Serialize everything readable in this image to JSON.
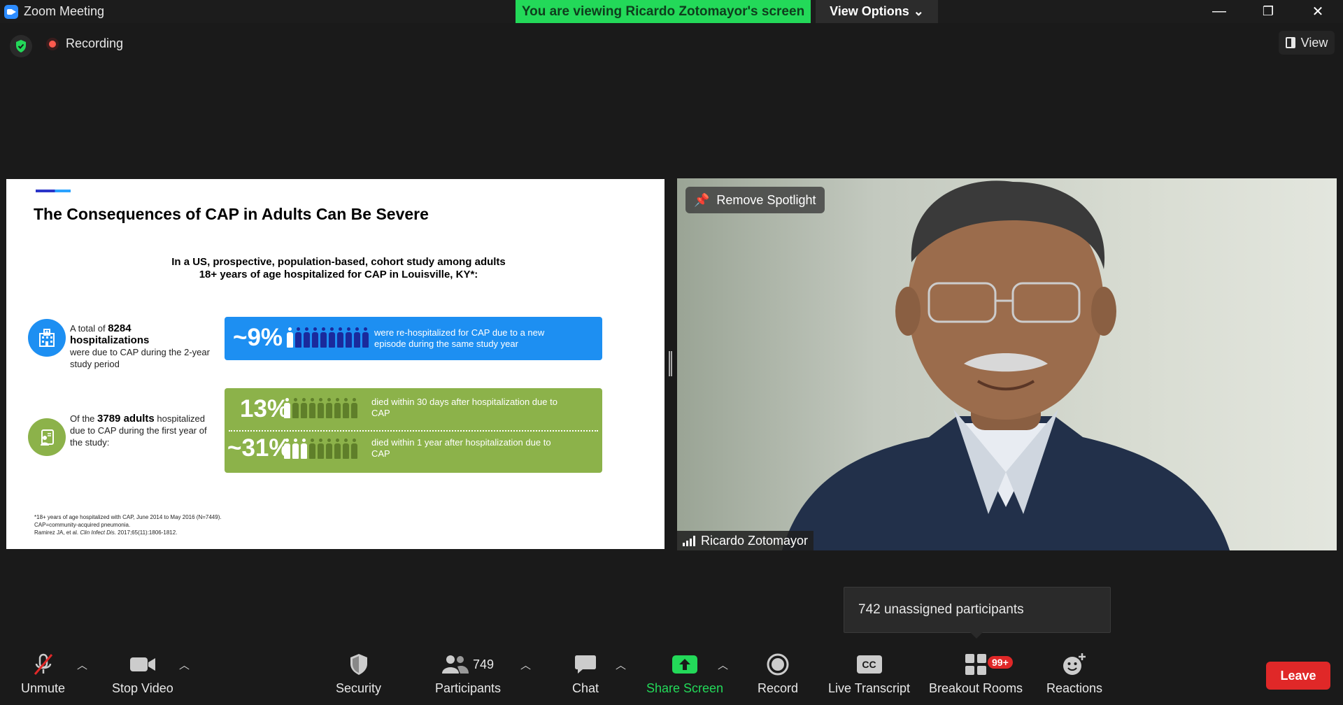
{
  "window": {
    "title": "Zoom Meeting",
    "viewing_banner": "You are viewing Ricardo Zotomayor's screen",
    "view_options": "View Options",
    "minimize": "—",
    "restore": "❐",
    "close": "✕"
  },
  "status": {
    "recording_label": "Recording",
    "view_label": "View"
  },
  "slide": {
    "title": "The Consequences of CAP in Adults Can Be Severe",
    "subtitle_line1": "In a US, prospective, population-based, cohort study among adults",
    "subtitle_line2": "18+ years of age hospitalized for CAP in Louisville, KY*:",
    "block1_prefix": "A total of ",
    "block1_bold": "8284 hospitalizations",
    "block1_rest": "were due to CAP during the 2-year study period",
    "block2_prefix": "Of the ",
    "block2_bold": "3789 adults",
    "block2_rest": " hospitalized due to CAP during the first year of the study:",
    "stat1_pct": "~9%",
    "stat1_text": "were re-hospitalized for CAP due to a new episode during the same study year",
    "stat2_pct": "13%",
    "stat2_text": "died within 30 days after hospitalization due to CAP",
    "stat3_pct": "~31%",
    "stat3_text": "died within 1 year after hospitalization due to CAP",
    "footnote1": "*18+ years of age hospitalized with CAP, June 2014 to May 2016 (N=7449).",
    "footnote2": "CAP=community-acquired pneumonia.",
    "footnote3_a": "Ramirez JA, et al. ",
    "footnote3_b": "Clin Infect Dis.",
    "footnote3_c": " 2017;65(11):1806-1812."
  },
  "video": {
    "remove_spotlight": "Remove Spotlight",
    "participant_name": "Ricardo Zotomayor"
  },
  "tooltip": {
    "text": "742 unassigned participants"
  },
  "toolbar": {
    "unmute": "Unmute",
    "stop_video": "Stop Video",
    "security": "Security",
    "participants": "Participants",
    "participants_count": "749",
    "chat": "Chat",
    "share_screen": "Share Screen",
    "record": "Record",
    "live_transcript": "Live Transcript",
    "breakout_rooms": "Breakout Rooms",
    "breakout_badge": "99+",
    "reactions": "Reactions",
    "leave": "Leave",
    "cc_icon_text": "CC"
  },
  "colors": {
    "banner_green": "#23d959",
    "slide_blue": "#1d8ff2",
    "slide_green": "#8cb24a",
    "leave_red": "#e02828"
  }
}
